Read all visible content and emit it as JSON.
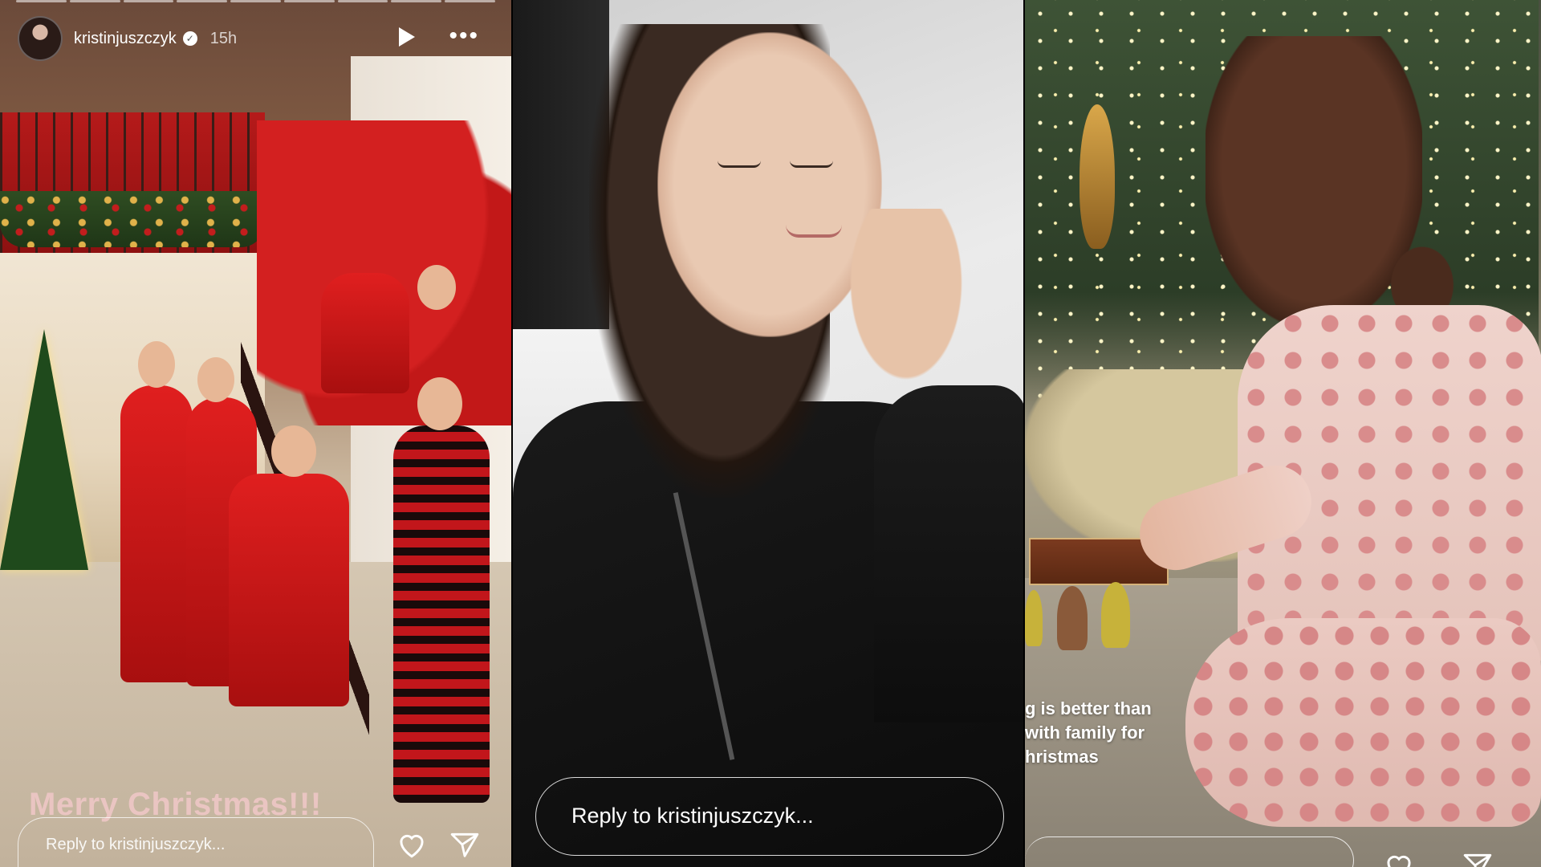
{
  "story1": {
    "username": "kristinjuszczyk",
    "time_ago": "15h",
    "caption": "Merry Christmas!!!",
    "reply_placeholder": "Reply to kristinjuszczyk...",
    "icons": [
      "play-icon",
      "more-icon",
      "heart-icon",
      "send-icon",
      "verified-icon"
    ]
  },
  "story2": {
    "reply_placeholder": "Reply to kristinjuszczyk..."
  },
  "story3": {
    "caption_lines": [
      "g is better than",
      "with family for",
      "hristmas"
    ]
  },
  "colors": {
    "pajama_red": "#e01f1f",
    "hoodie_black": "#111111",
    "reply_border": "#ffffff"
  }
}
